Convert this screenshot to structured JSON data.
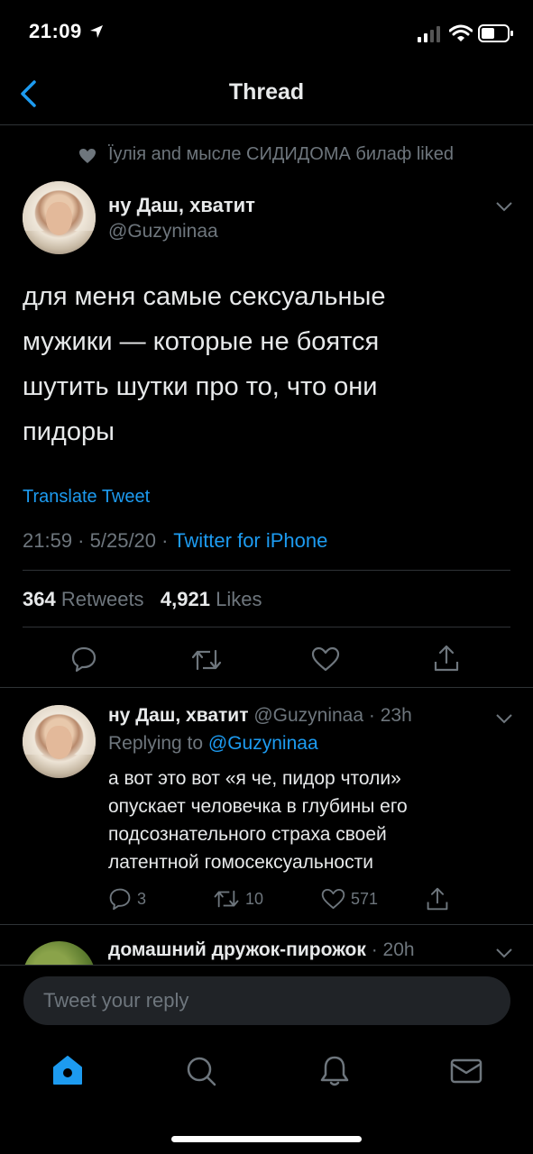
{
  "status_bar": {
    "time": "21:09"
  },
  "nav": {
    "title": "Thread"
  },
  "social_context": {
    "text": "Їулія and мысле СИДИДОМА билаф liked"
  },
  "main_tweet": {
    "display_name": "ну Даш, хватит",
    "handle": "@Guzyninaa",
    "text_lines": [
      "для меня самые сексуальные",
      "мужики — которые не боятся",
      "шутить шутки про то, что они",
      "пидоры"
    ],
    "translate": "Translate Tweet",
    "time": "21:59",
    "date": "5/25/20",
    "source": "Twitter for iPhone",
    "retweets_count": "364",
    "retweets_label": "Retweets",
    "likes_count": "4,921",
    "likes_label": "Likes"
  },
  "reply": {
    "display_name": "ну Даш, хватит",
    "handle": "@Guzyninaa",
    "time": "23h",
    "replying_label": "Replying to",
    "replying_handle": "@Guzyninaa",
    "text_lines": [
      "а вот это вот «я че, пидор чтоли»",
      "опускает человечка в глубины его",
      "подсознательного страха своей",
      "латентной гомосексуальности"
    ],
    "replies": "3",
    "retweets": "10",
    "likes": "571"
  },
  "next_reply": {
    "display_name": "домашний дружок-пирожок",
    "time": "20h"
  },
  "composer": {
    "placeholder": "Tweet your reply"
  },
  "tabs": [
    "home-icon",
    "search-icon",
    "notifications-icon",
    "messages-icon"
  ],
  "colors": {
    "background": "#000000",
    "accent": "#1d9bf0",
    "secondary_text": "#6e767d",
    "divider": "#2f3336"
  }
}
